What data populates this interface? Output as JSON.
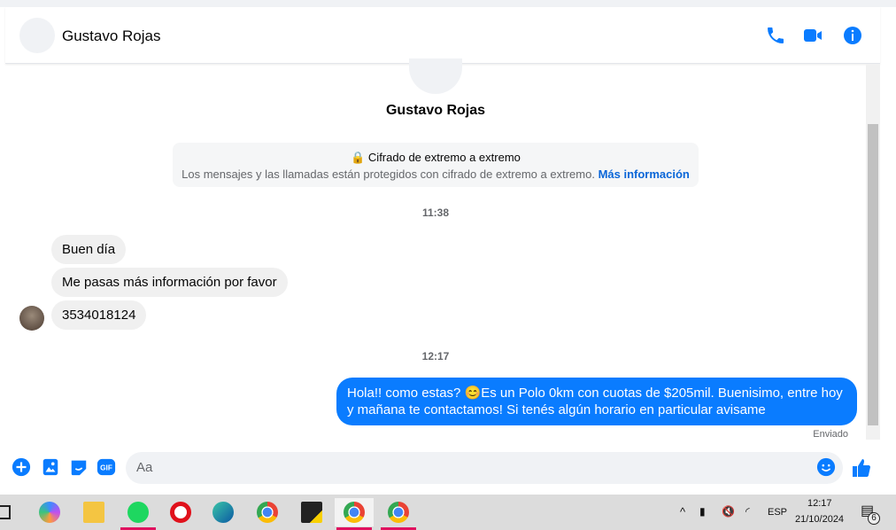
{
  "contact": {
    "name": "Gustavo Rojas"
  },
  "header_icons": [
    "phone-icon",
    "video-icon",
    "info-icon"
  ],
  "encryption": {
    "title": "Cifrado de extremo a extremo",
    "text": "Los mensajes y las llamadas están protegidos con cifrado de extremo a extremo.",
    "link": "Más información"
  },
  "times": [
    "11:38",
    "12:17"
  ],
  "incoming": [
    "Buen día",
    "Me pasas más información por favor",
    "3534018124"
  ],
  "outgoing": {
    "text": "Hola!! como estas? 😊Es un Polo 0km con cuotas de $205mil. Buenisimo, entre hoy y mañana te contactamos! Si tenés algún horario en particular avisame",
    "status": "Enviado"
  },
  "composer": {
    "placeholder": "Aa"
  },
  "taskbar": {
    "lang": "ESP",
    "time": "12:17",
    "date": "21/10/2024",
    "notifications": "6"
  },
  "colors": {
    "accent": "#0a7cff",
    "bubble_in": "#f0f0f0"
  }
}
